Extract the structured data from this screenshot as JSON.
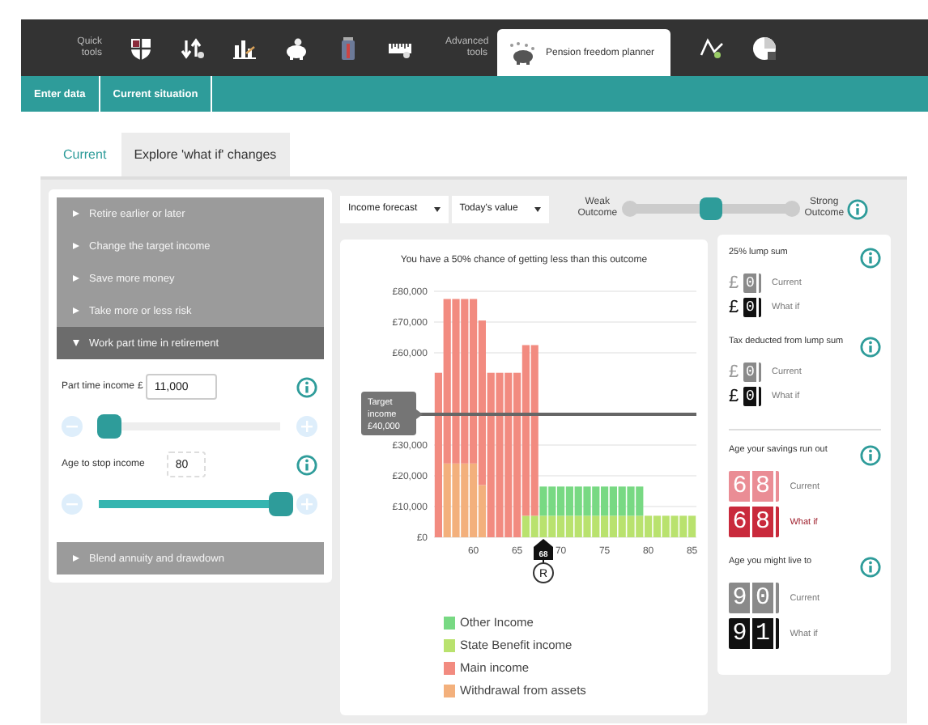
{
  "toolbar": {
    "quick_label": "Quick tools",
    "advanced_label": "Advanced tools",
    "active_tool": "Pension freedom planner"
  },
  "subnav": [
    "Enter data",
    "Current situation"
  ],
  "tabs": [
    {
      "label": "Current",
      "selected": false
    },
    {
      "label": "Explore 'what if' changes",
      "selected": true
    }
  ],
  "accordion": [
    {
      "label": "Retire earlier or later",
      "expanded": false
    },
    {
      "label": "Change the target income",
      "expanded": false
    },
    {
      "label": "Save more money",
      "expanded": false
    },
    {
      "label": "Take more or less risk",
      "expanded": false
    },
    {
      "label": "Work part time in retirement",
      "expanded": true,
      "controls": [
        {
          "label": "Part time income",
          "prefix": "£",
          "value": "11,000",
          "level": 0.05,
          "boxed": true
        },
        {
          "label": "Age to stop income",
          "value": "80",
          "level": 1,
          "boxed": false
        }
      ]
    },
    {
      "label": "Blend annuity and drawdown",
      "expanded": false
    }
  ],
  "selects": [
    {
      "value": "Income forecast"
    },
    {
      "value": "Today's value"
    }
  ],
  "outcome": {
    "left": "Weak Outcome",
    "right": "Strong Outcome",
    "level": 0.5
  },
  "chart": {
    "title": "You have a 50% chance of getting less than this outcome",
    "chart_data": {
      "type": "bar",
      "stacked": true,
      "grid": true,
      "x": [
        56,
        57,
        58,
        59,
        60,
        61,
        62,
        63,
        64,
        65,
        66,
        67,
        68,
        69,
        70,
        71,
        72,
        73,
        74,
        75,
        76,
        77,
        78,
        79,
        80,
        81,
        82,
        83,
        84,
        85
      ],
      "series": [
        {
          "name": "Other Income",
          "color": "#78d983",
          "values": [
            0,
            0,
            0,
            0,
            0,
            0,
            0,
            0,
            0,
            0,
            0,
            0,
            9500,
            9500,
            9500,
            9500,
            9500,
            9500,
            9500,
            9500,
            9500,
            9500,
            9500,
            9500,
            0,
            0,
            0,
            0,
            0,
            0
          ]
        },
        {
          "name": "State Benefit income",
          "color": "#b9e26e",
          "values": [
            0,
            0,
            0,
            0,
            0,
            0,
            0,
            0,
            0,
            0,
            7000,
            7000,
            7000,
            7000,
            7000,
            7000,
            7000,
            7000,
            7000,
            7000,
            7000,
            7000,
            7000,
            7000,
            7000,
            7000,
            7000,
            7000,
            7000,
            7000
          ]
        },
        {
          "name": "Main income",
          "color": "#f28b80",
          "values": [
            53500,
            53500,
            53500,
            53500,
            53500,
            53500,
            53500,
            53500,
            53500,
            53500,
            55500,
            55500,
            0,
            0,
            0,
            0,
            0,
            0,
            0,
            0,
            0,
            0,
            0,
            0,
            0,
            0,
            0,
            0,
            0,
            0
          ]
        },
        {
          "name": "Withdrawal from assets",
          "color": "#f3b07c",
          "values": [
            0,
            24000,
            24000,
            24000,
            24000,
            17000,
            0,
            0,
            0,
            0,
            0,
            0,
            0,
            0,
            0,
            0,
            0,
            0,
            0,
            0,
            0,
            0,
            0,
            0,
            0,
            0,
            0,
            0,
            0,
            0
          ]
        }
      ],
      "ylim": [
        0,
        80000
      ],
      "yticks": [
        {
          "value": 0,
          "label": "£0"
        },
        {
          "value": 10000,
          "label": "£10,000"
        },
        {
          "value": 20000,
          "label": "£20,000"
        },
        {
          "value": 30000,
          "label": "£30,000"
        },
        {
          "value": 60000,
          "label": "£60,000"
        },
        {
          "value": 70000,
          "label": "£70,000"
        },
        {
          "value": 80000,
          "label": "£80,000"
        }
      ],
      "xlim": [
        55.5,
        85.5
      ],
      "xticks": [
        60,
        65,
        70,
        75,
        80,
        85
      ],
      "ref_lines": [
        {
          "axis": "y",
          "value": 40000,
          "label": "Target income £40,000"
        }
      ]
    },
    "marker": {
      "label": "68",
      "pin": "R"
    }
  },
  "metric_groups": [
    [
      {
        "title": "25% lump sum",
        "alert": false,
        "rows": [
          {
            "prefix": "£",
            "value": "0",
            "label": "Current",
            "kind": "current"
          },
          {
            "prefix": "£",
            "value": "0",
            "label": "What if",
            "kind": "whatif"
          }
        ]
      },
      {
        "title": "Tax deducted from lump sum",
        "alert": false,
        "rows": [
          {
            "prefix": "£",
            "value": "0",
            "label": "Current",
            "kind": "current"
          },
          {
            "prefix": "£",
            "value": "0",
            "label": "What if",
            "kind": "whatif"
          }
        ]
      }
    ],
    [
      {
        "title": "Age your savings run out",
        "alert": true,
        "rows": [
          {
            "value": "68",
            "label": "Current",
            "kind": "current"
          },
          {
            "value": "68",
            "label": "What if",
            "kind": "whatif"
          }
        ]
      },
      {
        "title": "Age you might live to",
        "alert": false,
        "rows": [
          {
            "value": "90",
            "label": "Current",
            "kind": "current"
          },
          {
            "value": "91",
            "label": "What if",
            "kind": "whatif"
          }
        ]
      }
    ]
  ]
}
